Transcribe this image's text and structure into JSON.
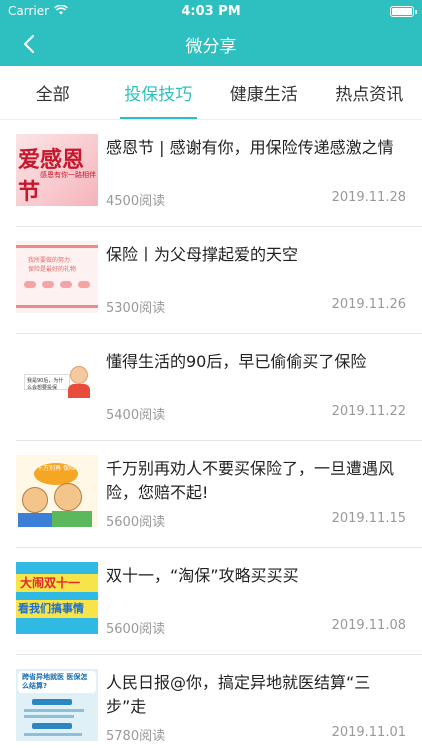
{
  "status_bar": {
    "carrier": "Carrier",
    "time": "4:03 PM"
  },
  "nav": {
    "title": "微分享"
  },
  "tabs": [
    {
      "label": "全部",
      "active": false
    },
    {
      "label": "投保技巧",
      "active": true
    },
    {
      "label": "健康生活",
      "active": false
    },
    {
      "label": "热点资讯",
      "active": false
    }
  ],
  "articles": [
    {
      "title": "感恩节 | 感谢有你，用保险传递感激之情",
      "reads": "4500阅读",
      "date": "2019.11.28",
      "thumb": {
        "big": "爱感恩节",
        "small": "感恩有你一路相伴"
      }
    },
    {
      "title": "保险丨为父母撑起爱的天空",
      "reads": "5300阅读",
      "date": "2019.11.26",
      "thumb": {
        "line1": "我所要做的努力",
        "line2": "保险是最好的礼物"
      }
    },
    {
      "title": "懂得生活的90后，早已偷偷买了保险",
      "reads": "5400阅读",
      "date": "2019.11.22",
      "thumb": {
        "box": "我是90后，为什么会想要投保"
      }
    },
    {
      "title": "千万别再劝人不要买保险了，一旦遭遇风险，您赔不起!",
      "reads": "5600阅读",
      "date": "2019.11.15",
      "thumb": {
        "tag": "千万别再 保险"
      }
    },
    {
      "title": "双十一，“淘保”攻略买买买",
      "reads": "5600阅读",
      "date": "2019.11.08",
      "thumb": {
        "band1": "大闹双十一",
        "band2": "看我们搞事情"
      }
    },
    {
      "title": "人民日报@你，搞定异地就医结算“三步”走",
      "reads": "5780阅读",
      "date": "2019.11.01",
      "thumb": {
        "head": "跨省异地就医 医保怎么结算?"
      }
    }
  ],
  "colors": {
    "brand": "#2ebfc0",
    "meta": "#999999"
  }
}
